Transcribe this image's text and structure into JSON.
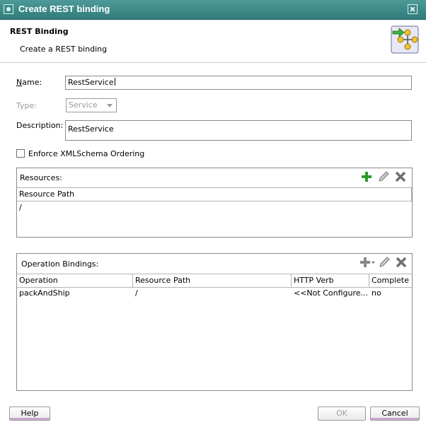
{
  "window": {
    "title": "Create REST binding"
  },
  "header": {
    "title": "REST Binding",
    "subtitle": "Create a REST binding"
  },
  "form": {
    "name_label": "Name:",
    "name_value": "RestService",
    "type_label": "Type:",
    "type_value": "Service",
    "description_label": "Description:",
    "description_value": "RestService",
    "enforce_label": "Enforce XMLSchema Ordering",
    "enforce_checked": false
  },
  "resources": {
    "label": "Resources:",
    "columns": [
      "Resource Path"
    ],
    "rows": [
      [
        "/"
      ]
    ]
  },
  "operations": {
    "label": "Operation Bindings:",
    "columns": [
      "Operation",
      "Resource Path",
      "HTTP Verb",
      "Complete"
    ],
    "rows": [
      [
        "packAndShip",
        "/",
        "<<Not Configure...",
        "no"
      ]
    ]
  },
  "buttons": {
    "help": "Help",
    "ok": "OK",
    "cancel": "Cancel"
  },
  "icons": {
    "add": "plus-icon",
    "edit": "pencil-icon",
    "delete": "x-icon",
    "add_color": "#2e9a2e"
  }
}
